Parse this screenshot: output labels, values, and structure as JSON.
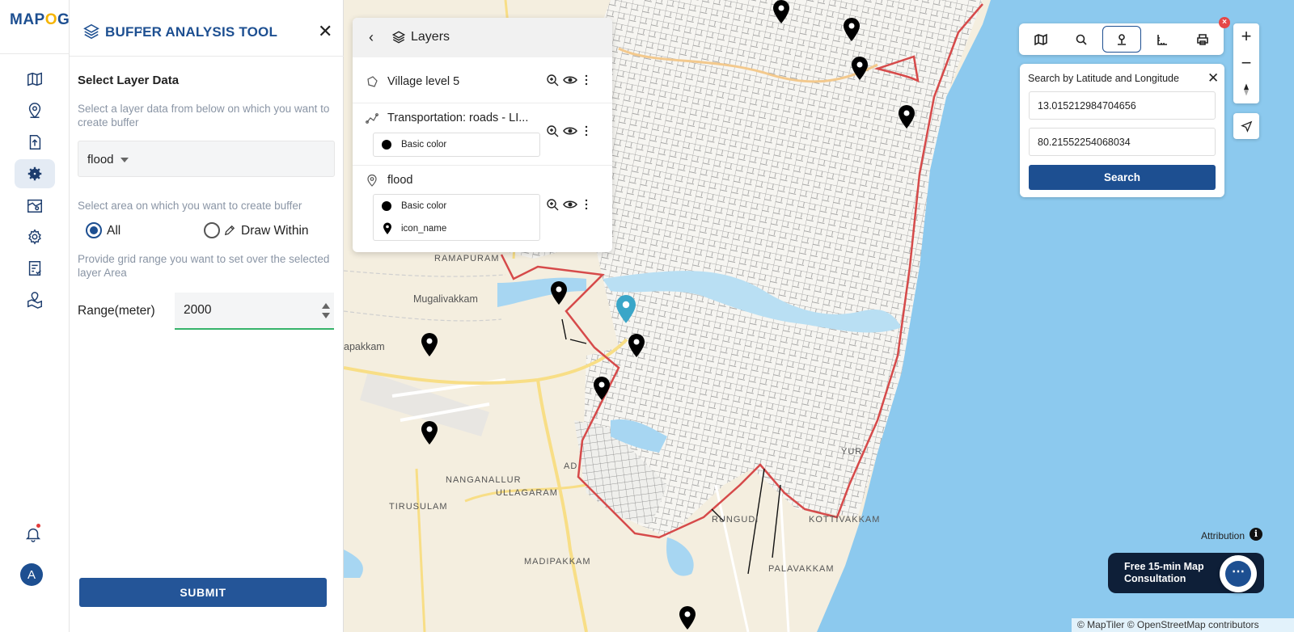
{
  "brand": {
    "logo_text_1": "MAP",
    "logo_text_2": "O",
    "logo_text_3": "G"
  },
  "rail": {
    "items": [
      {
        "icon": "map-icon"
      },
      {
        "icon": "location-pin-icon"
      },
      {
        "icon": "upload-icon"
      },
      {
        "icon": "settings-gear-icon",
        "active": true
      },
      {
        "icon": "map-analysis-icon"
      },
      {
        "icon": "gear-icon"
      },
      {
        "icon": "report-icon"
      },
      {
        "icon": "map-location-icon"
      }
    ],
    "avatar_initial": "A"
  },
  "panel": {
    "title": "BUFFER ANALYSIS TOOL",
    "select_heading": "Select Layer Data",
    "select_help": "Select a layer data from below on which you want to create buffer",
    "selected_layer": "flood",
    "area_help": "Select area on which you want to create buffer",
    "radio_all": "All",
    "radio_draw": "Draw Within",
    "grid_help": "Provide grid range you want to set over the selected layer Area",
    "range_label": "Range(meter)",
    "range_value": "2000",
    "submit_label": "SUBMIT"
  },
  "layers": {
    "title": "Layers",
    "items": [
      {
        "name": "Village level 5",
        "icon": "polygon-icon"
      },
      {
        "name": "Transportation: roads - LI...",
        "icon": "line-icon",
        "legend": [
          "Basic color"
        ]
      },
      {
        "name": "flood",
        "icon": "point-icon",
        "legend": [
          "Basic color",
          "icon_name"
        ]
      }
    ]
  },
  "map": {
    "places": [
      "RAMAPURAM",
      "Mugalivakkam",
      "apakkam",
      "NANGANALLUR",
      "ULLAGARAM",
      "TIRUSULAM",
      "MADIPAKKAM",
      "PALAVAKKAM",
      "RUNGUDI",
      "KOTTIVAKKAM",
      "YUR",
      "AD"
    ],
    "colors": {
      "sea": "#8cc9ee",
      "land": "#f4eedf",
      "urban": "#f6f5f1",
      "buffer_outline": "#d64a4a",
      "road_yellow": "#f8de86"
    }
  },
  "search": {
    "title": "Search by Latitude and Longitude",
    "latitude": "13.015212984704656",
    "longitude": "80.21552254068034",
    "button": "Search"
  },
  "tools": [
    "map-style-icon",
    "search-icon",
    "latlng-pin-icon",
    "measure-icon",
    "print-icon"
  ],
  "zoom": {
    "in": "+",
    "out": "−"
  },
  "attribution": "Attribution",
  "consult": "Free 15-min Map Consultation",
  "credits": "© MapTiler © OpenStreetMap contributors"
}
